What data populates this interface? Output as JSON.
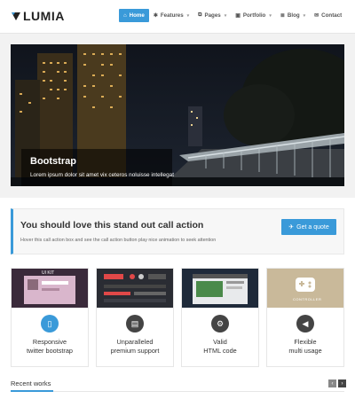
{
  "brand": {
    "name": "LUMIA"
  },
  "nav": [
    {
      "label": "Home",
      "icon": "home-icon",
      "active": true,
      "caret": false
    },
    {
      "label": "Features",
      "icon": "gear-icon",
      "active": false,
      "caret": true
    },
    {
      "label": "Pages",
      "icon": "pages-icon",
      "active": false,
      "caret": true
    },
    {
      "label": "Portfolio",
      "icon": "portfolio-icon",
      "active": false,
      "caret": true
    },
    {
      "label": "Blog",
      "icon": "blog-icon",
      "active": false,
      "caret": true
    },
    {
      "label": "Contact",
      "icon": "envelope-icon",
      "active": false,
      "caret": false
    }
  ],
  "slider": {
    "title": "Bootstrap",
    "text": "Lorem ipsum dolor sit amet vix ceteros noluisse intellegat"
  },
  "cta": {
    "title": "You should love this stand out call action",
    "subtitle": "Hover this call action box and see the call action button play nice animation to seek attention",
    "button": "Get a quote"
  },
  "features": [
    {
      "label1": "Responsive",
      "label2": "twitter bootstrap",
      "icon": "mobile-icon",
      "thumb_text": "UI KIT"
    },
    {
      "label1": "Unparalleled",
      "label2": "premium support",
      "icon": "briefcase-icon",
      "thumb_text": ""
    },
    {
      "label1": "Valid",
      "label2": "HTML code",
      "icon": "cogs-icon",
      "thumb_text": ""
    },
    {
      "label1": "Flexible",
      "label2": "multi usage",
      "icon": "megaphone-icon",
      "thumb_text": "CONTROLLER"
    }
  ],
  "recent": {
    "title": "Recent works"
  },
  "colors": {
    "accent": "#3a9ad9",
    "feature_circle": "#3a9ad9",
    "feature_circle_dark": "#444444"
  }
}
